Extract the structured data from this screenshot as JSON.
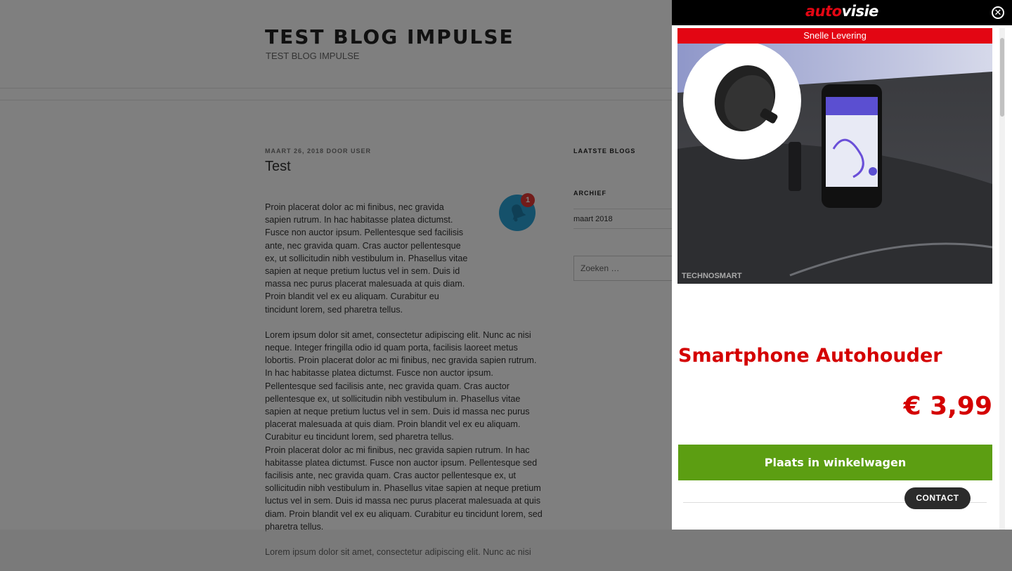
{
  "site": {
    "title": "TEST BLOG IMPULSE",
    "description": "TEST BLOG IMPULSE"
  },
  "post": {
    "meta": "MAART 26, 2018 DOOR USER",
    "title": "Test",
    "paragraphs": [
      "Proin placerat dolor ac mi finibus, nec gravida sapien rutrum. In hac habitasse platea dictumst. Fusce non auctor ipsum. Pellentesque sed facilisis ante, nec gravida quam. Cras auctor pellentesque ex, ut sollicitudin nibh vestibulum in. Phasellus vitae sapien at neque pretium luctus vel in sem. Duis id massa nec purus placerat malesuada at quis diam. Proin blandit vel ex eu aliquam. Curabitur eu tincidunt lorem, sed pharetra tellus.",
      "Lorem ipsum dolor sit amet, consectetur adipiscing elit. Nunc ac nisi neque. Integer fringilla odio id quam porta, facilisis laoreet metus lobortis. Proin placerat dolor ac mi finibus, nec gravida sapien rutrum. In hac habitasse platea dictumst. Fusce non auctor ipsum. Pellentesque sed facilisis ante, nec gravida quam. Cras auctor pellentesque ex, ut sollicitudin nibh vestibulum in. Phasellus vitae sapien at neque pretium luctus vel in sem. Duis id massa nec purus placerat malesuada at quis diam. Proin blandit vel ex eu aliquam. Curabitur eu tincidunt lorem, sed pharetra tellus.",
      "Proin placerat dolor ac mi finibus, nec gravida sapien rutrum. In hac habitasse platea dictumst. Fusce non auctor ipsum. Pellentesque sed facilisis ante, nec gravida quam. Cras auctor pellentesque ex, ut sollicitudin nibh vestibulum in. Phasellus vitae sapien at neque pretium luctus vel in sem. Duis id massa nec purus placerat malesuada at quis diam. Proin blandit vel ex eu aliquam. Curabitur eu tincidunt lorem, sed pharetra tellus.",
      "Lorem ipsum dolor sit amet, consectetur adipiscing elit. Nunc ac nisi"
    ]
  },
  "notification": {
    "count": "1",
    "icon": "bell-icon",
    "color": "#2aa3d6"
  },
  "sidebar": {
    "latest_title": "LAATSTE BLOGS",
    "archive_title": "ARCHIEF",
    "archive_items": [
      "maart 2018"
    ],
    "search_placeholder": "Zoeken …"
  },
  "panel": {
    "logo_part1": "auto",
    "logo_part2": "visie",
    "close_icon": "close-icon",
    "banner": "Snelle Levering",
    "image_watermark": "TECHNOSMART",
    "product_title": "Smartphone Autohouder",
    "price": "€ 3,99",
    "cart_button": "Plaats in winkelwagen",
    "contact_button": "CONTACT",
    "colors": {
      "brand_red": "#e30613",
      "title_red": "#d40000",
      "cart_green": "#5c9e12"
    }
  }
}
